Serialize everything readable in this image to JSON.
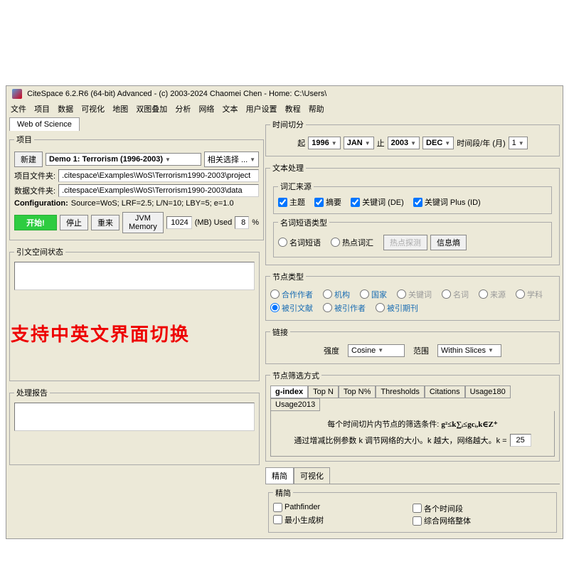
{
  "title": "CiteSpace 6.2.R6 (64-bit) Advanced - (c) 2003-2024 Chaomei Chen - Home: C:\\Users\\",
  "menu": {
    "m1": "文件",
    "m2": "项目",
    "m3": "数据",
    "m4": "可视化",
    "m5": "地图",
    "m6": "双图叠加",
    "m7": "分析",
    "m8": "网络",
    "m9": "文本",
    "m10": "用户设置",
    "m11": "教程",
    "m12": "帮助"
  },
  "dataTab": "Web of Science",
  "project": {
    "legend": "项目",
    "newBtn": "新建",
    "demo": "Demo 1: Terrorism (1996-2003)",
    "related": "相关选择 ...",
    "projFileLabel": "项目文件夹:",
    "projFile": ".citespace\\Examples\\WoS\\Terrorism1990-2003\\project",
    "dataFileLabel": "数据文件夹:",
    "dataFile": ".citespace\\Examples\\WoS\\Terrorism1990-2003\\data",
    "configLabel": "Configuration:",
    "config": "Source=WoS; LRF=2.5; L/N=10; LBY=5; e=1.0",
    "go": "开始!",
    "stop": "停止",
    "reset": "重来",
    "jvm": "JVM Memory",
    "mem": "1024",
    "memUsed": "(MB) Used",
    "pct": "8",
    "pctSign": "%"
  },
  "citeSpace": "引文空间状态",
  "procReport": "处理报告",
  "overlay": "支持中英文界面切换",
  "timeslice": {
    "legend": "时间切分",
    "from": "起",
    "y1": "1996",
    "m1": "JAN",
    "to": "止",
    "y2": "2003",
    "m2": "DEC",
    "per": "时间段/年 (月)",
    "n": "1"
  },
  "textproc": {
    "legend": "文本处理",
    "vocSrc": "词汇来源",
    "c1": "主题",
    "c2": "摘要",
    "c3": "关键词 (DE)",
    "c4": "关键词 Plus (ID)",
    "nounType": "名词短语类型",
    "r1": "名词短语",
    "r2": "热点词汇",
    "hotBtn": "热点探测",
    "infoBtn": "信息熵"
  },
  "nodetype": {
    "legend": "节点类型",
    "r1": "合作作者",
    "r2": "机构",
    "r3": "国家",
    "r4": "关键词",
    "r5": "名词",
    "r6": "来源",
    "r7": "学科",
    "r8": "被引文献",
    "r9": "被引作者",
    "r10": "被引期刊"
  },
  "links": {
    "legend": "链接",
    "strength": "强度",
    "cosine": "Cosine",
    "scope": "范围",
    "within": "Within Slices"
  },
  "nodesel": {
    "legend": "节点筛选方式",
    "t1": "g-index",
    "t2": "Top N",
    "t3": "Top N%",
    "t4": "Thresholds",
    "t5": "Citations",
    "t6": "Usage180",
    "t7": "Usage2013",
    "line1a": "每个时间切片内节点的筛选条件: ",
    "line1b": "g²≤k∑ᵢ≤gcᵢ,k∈Z⁺",
    "line2a": "通过增减比例参数 k 调节网络的大小。k 越大，网络越大。k = ",
    "k": "25"
  },
  "prune": {
    "t1": "精简",
    "t2": "可视化",
    "legend": "精简",
    "c1": "Pathfinder",
    "c2": "最小生成树",
    "c3": "各个时间段",
    "c4": "综合网络整体"
  }
}
